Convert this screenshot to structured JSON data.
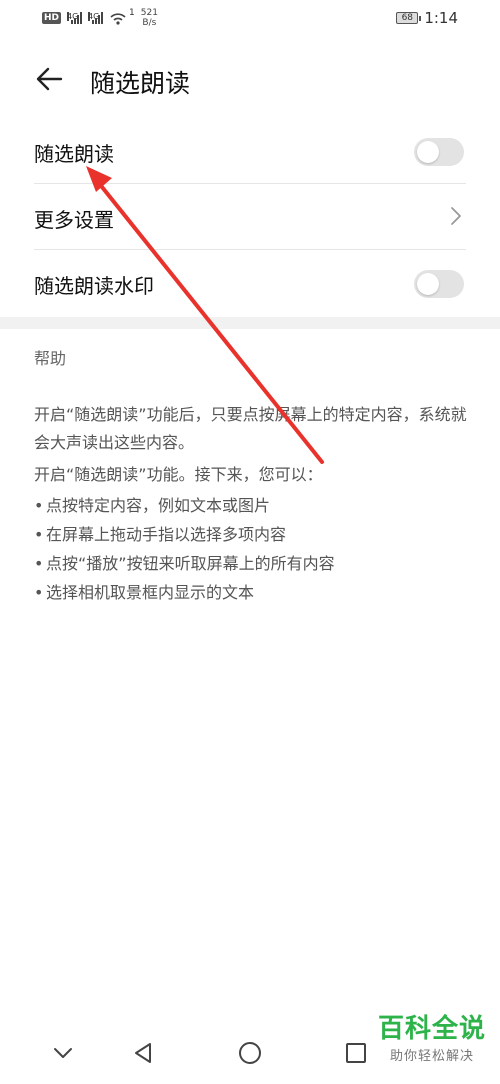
{
  "status_bar": {
    "hd_badge": "HD",
    "net_tag_1": "4G",
    "net_tag_2": "4G",
    "wifi_sup": "1",
    "speed_value": "521",
    "speed_unit": "B/s",
    "battery": "68",
    "time": "1:14"
  },
  "app_bar": {
    "title": "随选朗读"
  },
  "settings": [
    {
      "label": "随选朗读",
      "control": "toggle",
      "checked": false
    },
    {
      "label": "更多设置",
      "control": "chevron"
    },
    {
      "label": "随选朗读水印",
      "control": "toggle",
      "checked": false
    }
  ],
  "help": {
    "title": "帮助",
    "paragraph1": "开启“随选朗读”功能后，只要点按屏幕上的特定内容，系统就会大声读出这些内容。",
    "paragraph2": "开启“随选朗读”功能。接下来，您可以：",
    "bullets": [
      "点按特定内容，例如文本或图片",
      "在屏幕上拖动手指以选择多项内容",
      "点按“播放”按钮来听取屏幕上的所有内容",
      "选择相机取景框内显示的文本"
    ],
    "bullet_char": "•"
  },
  "navigation_bar": {
    "icons": [
      "chevron-down-icon",
      "back-triangle-icon",
      "home-circle-icon",
      "recents-square-icon"
    ]
  },
  "watermark": {
    "brand": "百科全说",
    "tagline": "助你轻松解决"
  },
  "colors": {
    "annotation_arrow": "#e8322b",
    "toggle_off": "#e3e3e3",
    "watermark_green": "#2db34a"
  }
}
